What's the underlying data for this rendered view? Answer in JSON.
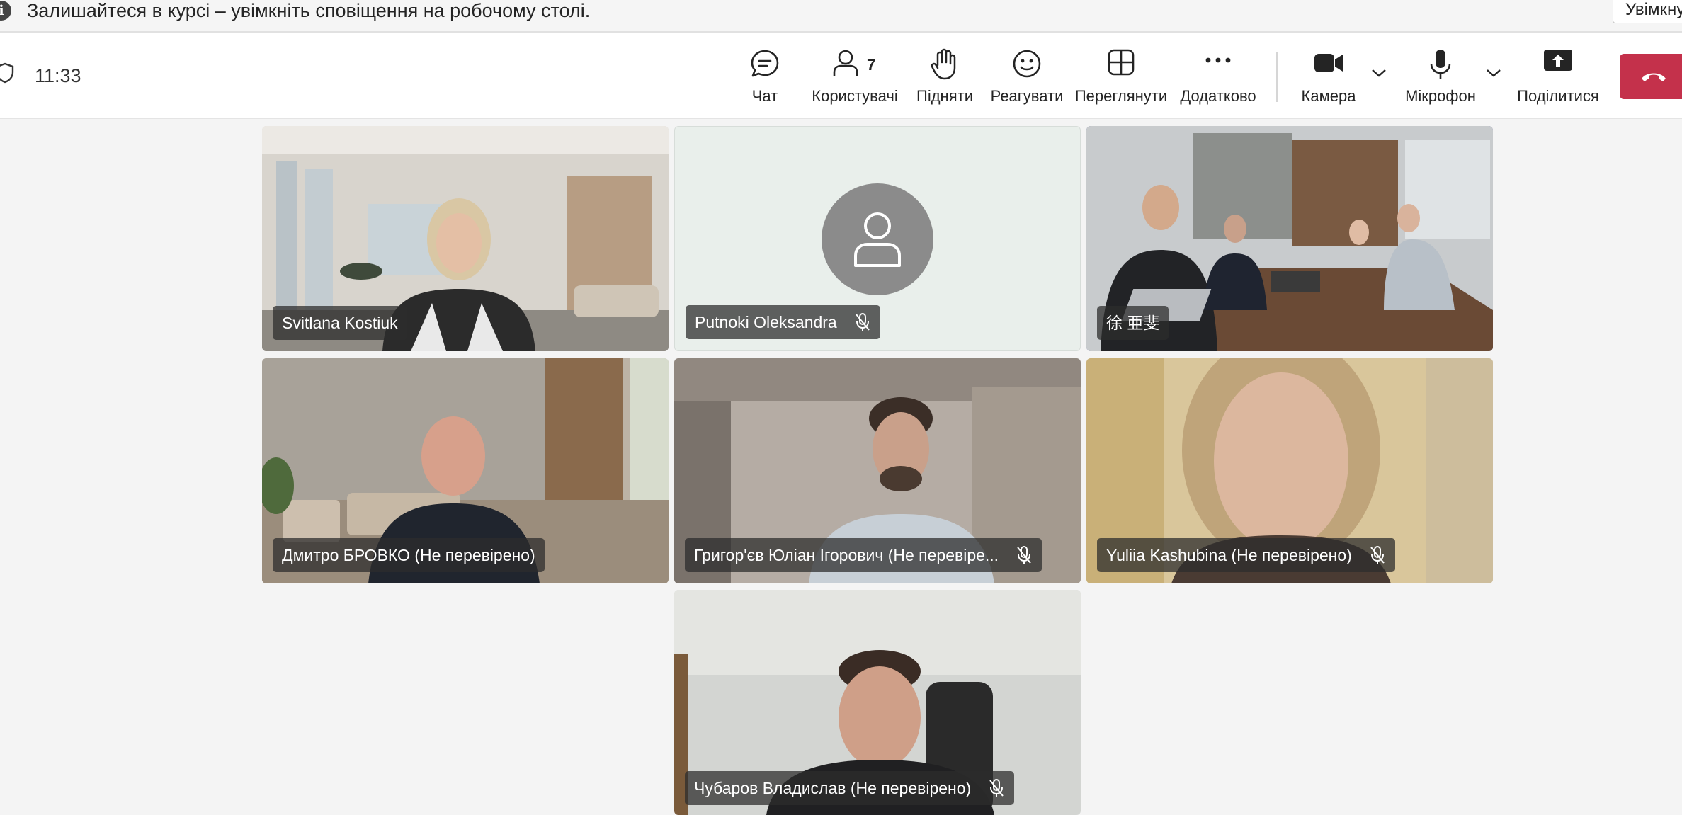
{
  "notification": {
    "text": "Залишайтеся в курсі – увімкніть сповіщення на робочому столі.",
    "button_label": "Увімкнути"
  },
  "toolbar": {
    "time": "11:33",
    "participants_count": "7",
    "buttons": {
      "chat": "Чат",
      "people": "Користувачі",
      "raise": "Підняти",
      "react": "Реагувати",
      "view": "Переглянути",
      "more": "Додатково",
      "camera": "Камера",
      "mic": "Мікрофон",
      "share": "Поділитися"
    },
    "colors": {
      "leave": "#c4314b",
      "active_tile": "#6264a7"
    }
  },
  "participants": [
    {
      "name": "Svitlana Kostiuk",
      "muted": false,
      "video": true
    },
    {
      "name": "Putnoki Oleksandra",
      "muted": true,
      "video": false
    },
    {
      "name": "徐 亜斐",
      "muted": false,
      "video": true,
      "active": true
    },
    {
      "name": "Дмитро БРОВКО (Не перевірено)",
      "muted": false,
      "video": true
    },
    {
      "name": "Григор'єв Юліан Ігорович (Не перевіре...",
      "muted": true,
      "video": true
    },
    {
      "name": "Yuliia Kashubina (Не перевірено)",
      "muted": true,
      "video": true
    },
    {
      "name": "Чубаров Владислав (Не перевірено)",
      "muted": true,
      "video": true
    }
  ]
}
